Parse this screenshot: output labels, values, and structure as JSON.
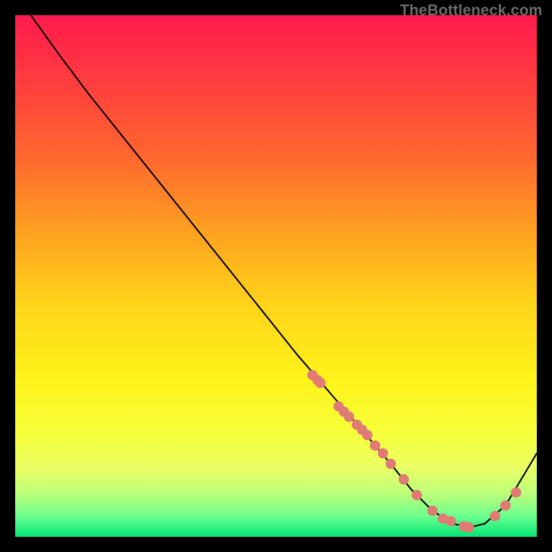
{
  "watermark": "TheBottleneck.com",
  "chart_data": {
    "type": "line",
    "title": "",
    "xlabel": "",
    "ylabel": "",
    "xlim": [
      0,
      100
    ],
    "ylim": [
      0,
      100
    ],
    "curve": {
      "x": [
        3,
        8,
        14,
        22,
        30,
        38,
        46,
        54,
        60,
        66,
        72,
        76,
        80,
        84,
        87,
        90,
        94,
        100
      ],
      "y": [
        100,
        93,
        85,
        75,
        65,
        55,
        45,
        35,
        28,
        21,
        14,
        9,
        5,
        2.5,
        1.8,
        2.5,
        6,
        16
      ]
    },
    "series": [
      {
        "name": "points-on-curve",
        "x": [
          57,
          58,
          58.5,
          62,
          63,
          64,
          65.5,
          66.5,
          67.5,
          69,
          70.5,
          72,
          74.5,
          77,
          80,
          82,
          83.5,
          86,
          87,
          92,
          94,
          96
        ],
        "y": [
          31,
          30,
          29.5,
          25,
          24,
          23,
          21.5,
          20.5,
          19.5,
          17.5,
          16,
          14,
          11,
          8,
          5,
          3.5,
          3,
          2,
          1.8,
          4,
          6,
          8.5
        ]
      }
    ],
    "colors": {
      "curve": "#000000",
      "points": "#e07a74"
    }
  }
}
